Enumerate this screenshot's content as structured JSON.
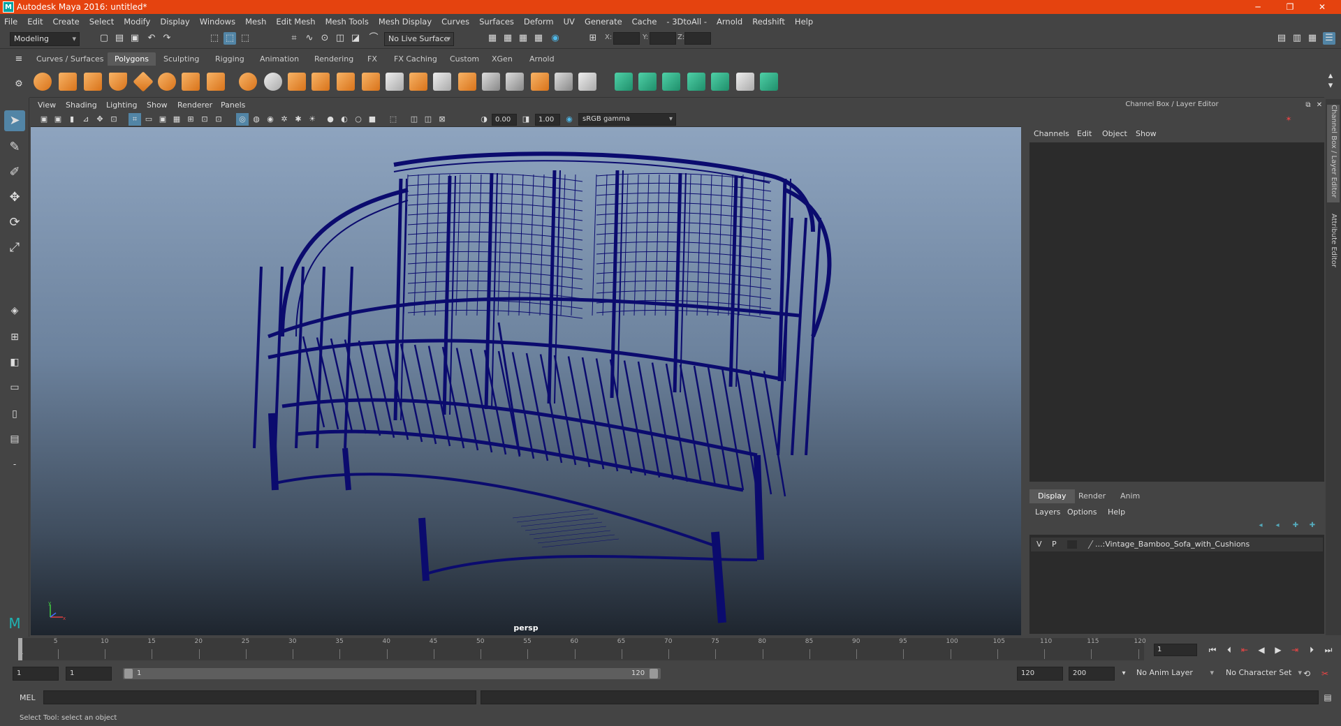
{
  "window": {
    "title": "Autodesk Maya 2016: untitled*",
    "minimize": "─",
    "maximize": "❐",
    "close": "✕"
  },
  "menus": [
    "File",
    "Edit",
    "Create",
    "Select",
    "Modify",
    "Display",
    "Windows",
    "Mesh",
    "Edit Mesh",
    "Mesh Tools",
    "Mesh Display",
    "Curves",
    "Surfaces",
    "Deform",
    "UV",
    "Generate",
    "Cache",
    "- 3DtoAll -",
    "Arnold",
    "Redshift",
    "Help"
  ],
  "statusline": {
    "mode": "Modeling",
    "live_surface": "No Live Surface",
    "x_label": "X:",
    "y_label": "Y:",
    "z_label": "Z:"
  },
  "shelf_tabs": [
    "Curves / Surfaces",
    "Polygons",
    "Sculpting",
    "Rigging",
    "Animation",
    "Rendering",
    "FX",
    "FX Caching",
    "Custom",
    "XGen",
    "Arnold"
  ],
  "active_shelf": "Polygons",
  "viewport": {
    "menus": [
      "View",
      "Shading",
      "Lighting",
      "Show",
      "Renderer",
      "Panels"
    ],
    "exposure": "0.00",
    "gamma": "1.00",
    "color_space": "sRGB gamma",
    "camera": "persp",
    "wire_color": "#0b0b6e"
  },
  "channel_box": {
    "title": "Channel Box / Layer Editor",
    "menus": [
      "Channels",
      "Edit",
      "Object",
      "Show"
    ]
  },
  "layer_editor": {
    "tabs": [
      "Display",
      "Render",
      "Anim"
    ],
    "active_tab": "Display",
    "menus": [
      "Layers",
      "Options",
      "Help"
    ],
    "layer": {
      "v": "V",
      "p": "P",
      "name": "...:Vintage_Bamboo_Sofa_with_Cushions"
    }
  },
  "side_tabs": [
    "Channel Box / Layer Editor",
    "Attribute Editor"
  ],
  "timeline": {
    "ticks": [
      "5",
      "10",
      "15",
      "20",
      "25",
      "30",
      "35",
      "40",
      "45",
      "50",
      "55",
      "60",
      "65",
      "70",
      "75",
      "80",
      "85",
      "90",
      "95",
      "100",
      "105",
      "110",
      "115",
      "120"
    ],
    "current_frame_label": "1",
    "current_frame": "1"
  },
  "range": {
    "start": "1",
    "playback_start": "1",
    "slider_start": "1",
    "slider_end": "120",
    "playback_end": "120",
    "end": "200",
    "anim_layer": "No Anim Layer",
    "character_set": "No Character Set"
  },
  "command": {
    "label": "MEL",
    "help": "Select Tool: select an object"
  }
}
